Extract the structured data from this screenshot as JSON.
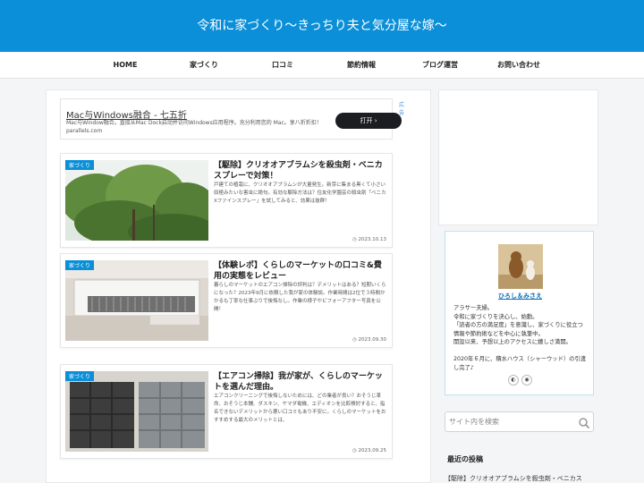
{
  "header": {
    "site_title": "令和に家づくり〜きっちり夫と気分屋な嫁〜"
  },
  "nav": {
    "items": [
      "HOME",
      "家づくり",
      "口コミ",
      "節約情報",
      "ブログ運営",
      "お問い合わせ"
    ]
  },
  "ad": {
    "title": "Mac与Windows融合 - 七五折",
    "description": "Mac与Window融合。直接从Mac Dock启动并访问Windows应用程序。充分利用您的 Mac。享八折折扣！parallels.com",
    "label": "広告",
    "open_button": "打开"
  },
  "posts": [
    {
      "category": "家づくり",
      "title": "【駆除】クリオオアブラムシを殺虫剤・ベニカスプレーで対策！",
      "excerpt": "戸建ての植栽に、クリオオアブラムシが大量発生。新芽に集まる黒くて小さい奴極みたいな害虫に絶句。有効な駆除方法は？住友化学園芸の殺虫剤「ベニカXファインスプレー」を試してみると、効果は抜群！",
      "date": "2023.10.13"
    },
    {
      "category": "家づくり",
      "title": "【体験レポ】くらしのマーケットの口コミ&費用の実態をレビュー",
      "excerpt": "暮らしのマーケットのエアコン掃除の評判は？デメリットはある？短期いくらになった？2023年9月に依頼した我が家の体験談。作業時間は2位で３時間かかるも丁寧な仕事ぶりで後悔なし。作業の様子やビフォーアフター写真を公開！",
      "date": "2023.09.30"
    },
    {
      "category": "家づくり",
      "title": "【エアコン掃除】我が家が、くらしのマーケットを選んだ理由。",
      "excerpt": "エアコンクリーニングで後悔しないためには、どの業者が良い？おそうじ革命、おそうじ本舗、ダスキン、ヤマダ電機、エディオンを比較検討すると、指名できないデメリットから悪い口コミもあり不安に。くらしのマーケットをおすすめする最大のメリットとは、",
      "date": "2023.09.25"
    }
  ],
  "profile": {
    "name": "ひろし＆みさえ",
    "bio": "アラサー夫婦。\n令和に家づくりを決心し、始動。\n「読者の方の満足度」を意識し、家づくりに役立つ情報や節約術などを中心に執筆中。\n開設以来、予想以上のアクセスに嬉しさ満開。\n\n2020年６月に、積水ハウス（シャーウッド）の引渡し完了♪",
    "social_icons": [
      "feedly-icon",
      "rss-icon"
    ]
  },
  "search": {
    "placeholder": "サイト内を検索"
  },
  "recent": {
    "heading": "最近の投稿",
    "first_item": "【駆除】クリオオアブラムシを殺虫剤・ベニカス"
  }
}
